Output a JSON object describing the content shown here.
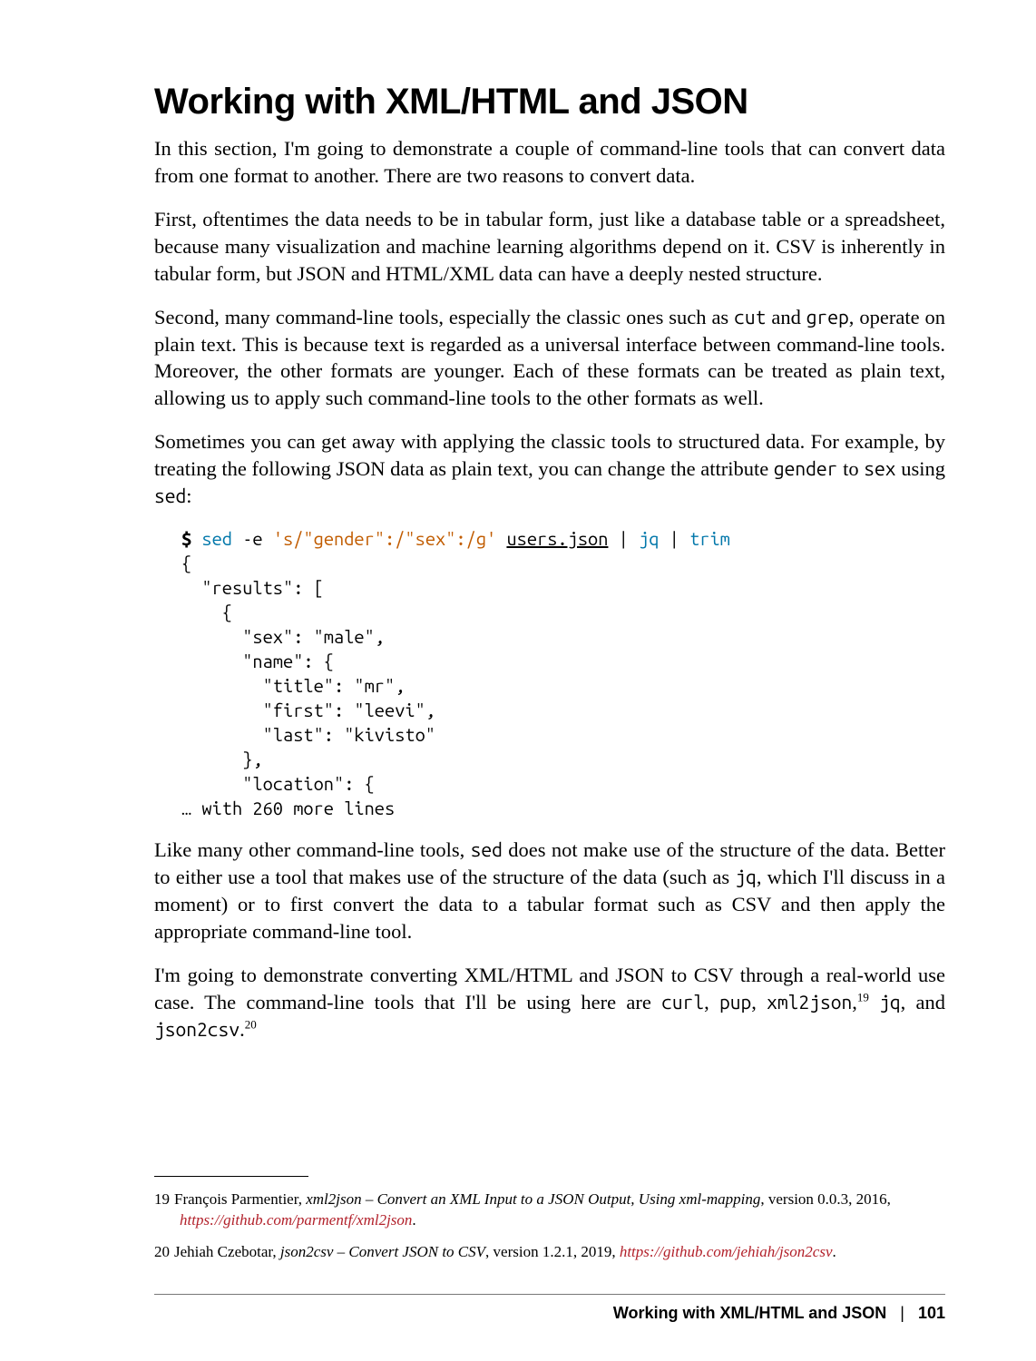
{
  "section": {
    "title": "Working with XML/HTML and JSON",
    "paragraphs": {
      "p1": "In this section, I'm going to demonstrate a couple of command-line tools that can convert data from one format to another. There are two reasons to convert data.",
      "p2": "First, oftentimes the data needs to be in tabular form, just like a database table or a spreadsheet, because many visualization and machine learning algorithms depend on it. CSV is inherently in tabular form, but JSON and HTML/XML data can have a deeply nested structure.",
      "p3a": "Second, many command-line tools, especially the classic ones such as ",
      "p3_code1": "cut",
      "p3b": " and ",
      "p3_code2": "grep",
      "p3c": ", operate on plain text. This is because text is regarded as a universal interface between command-line tools. Moreover, the other formats are younger. Each of these formats can be treated as plain text, allowing us to apply such command-line tools to the other formats as well.",
      "p4a": "Sometimes you can get away with applying the classic tools to structured data. For example, by treating the following JSON data as plain text, you can change the attribute ",
      "p4_code1": "gender",
      "p4b": " to ",
      "p4_code2": "sex",
      "p4c": " using ",
      "p4_code3": "sed",
      "p4d": ":",
      "p5a": "Like many other command-line tools, ",
      "p5_code1": "sed",
      "p5b": " does not make use of the structure of the data. Better to either use a tool that makes use of the structure of the data (such as ",
      "p5_code2": "jq",
      "p5c": ", which I'll discuss in a moment) or to first convert the data to a tabular format such as CSV and then apply the appropriate command-line tool.",
      "p6a": "I'm going to demonstrate converting XML/HTML and JSON to CSV through a real-world use case. The command-line tools that I'll be using here are ",
      "p6_code1": "curl",
      "p6b": ", ",
      "p6_code2": "pup",
      "p6c": ", ",
      "p6_code3": "xml2json",
      "p6d": ",",
      "p6_fn1": "19",
      "p6e": " ",
      "p6_code4": "jq",
      "p6f": ", and ",
      "p6_code5": "json2csv",
      "p6g": ".",
      "p6_fn2": "20"
    }
  },
  "code": {
    "prompt": "$",
    "cmd_sed": "sed",
    "flag_e": " -e ",
    "sed_expr": "'s/\"gender\":/\"sex\":/g'",
    "file": "users.json",
    "pipe1": " | ",
    "cmd_jq": "jq",
    "pipe2": " | ",
    "cmd_trim": "trim",
    "out_l1": "{",
    "out_l2": "  \"results\": [",
    "out_l3": "    {",
    "out_l4": "      \"sex\": \"male\",",
    "out_l5": "      \"name\": {",
    "out_l6": "        \"title\": \"mr\",",
    "out_l7": "        \"first\": \"leevi\",",
    "out_l8": "        \"last\": \"kivisto\"",
    "out_l9": "      },",
    "out_l10": "      \"location\": {",
    "out_more": "… with 260 more lines"
  },
  "footnotes": {
    "f19": {
      "num": "19",
      "pre": "François Parmentier, ",
      "title": "xml2json – Convert an XML Input to a JSON Output, Using xml-mapping",
      "post": ", version 0.0.3, 2016, ",
      "link": "https://github.com/parmentf/xml2json",
      "end": "."
    },
    "f20": {
      "num": "20",
      "pre": "Jehiah Czebotar, ",
      "title": "json2csv – Convert JSON to CSV",
      "post": ", version 1.2.1, 2019, ",
      "link": "https://github.com/jehiah/json2csv",
      "end": "."
    }
  },
  "footer": {
    "section": "Working with XML/HTML and JSON",
    "sep": "|",
    "page": "101"
  }
}
